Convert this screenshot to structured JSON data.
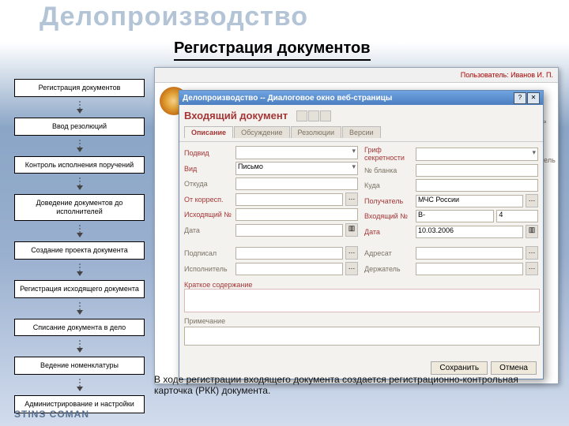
{
  "slide": {
    "title": "Делопроизводство",
    "subtitle": "Регистрация документов",
    "footer_text": "В ходе регистрации входящего документа создается регистрационно-контрольная карточка (РКК) документа.",
    "brand": "STINS COMAN"
  },
  "flow_steps": [
    "Регистрация документов",
    "Ввод резолюций",
    "Контроль исполнения поручений",
    "Доведение документов до исполнителей",
    "Создание проекта документа",
    "Регистрация исходящего документа",
    "Списание документа в дело",
    "Ведение номенклатуры",
    "Администрирование и настройки"
  ],
  "app": {
    "user_label": "Пользователь: Иванов И. П.",
    "back_title": "Делопроизводство",
    "consoles_label": "консоль",
    "holder_label": "держатель"
  },
  "dialog": {
    "title": "Делопроизводство -- Диалоговое окно веб-страницы",
    "window_title": "Входящий документ",
    "tabs": [
      "Описание",
      "Обсуждение",
      "Резолюции",
      "Версии"
    ],
    "left": {
      "podvid_lbl": "Подвид",
      "podvid_val": "",
      "vid_lbl": "Вид",
      "vid_val": "Письмо",
      "otkuda_lbl": "Откуда",
      "otkuda_val": "",
      "otkorresp_lbl": "От корресп.",
      "otkorresp_val": "",
      "iskhod_lbl": "Исходящий №",
      "iskhod_val": "",
      "data_lbl": "Дата",
      "data_val": ""
    },
    "right": {
      "grif_lbl": "Гриф секретности",
      "grif_val": "",
      "blank_lbl": "№ бланка",
      "blank_val": "",
      "kuda_lbl": "Куда",
      "kuda_val": "",
      "poluch_lbl": "Получатель",
      "poluch_val": "МЧС России",
      "vhod_lbl": "Входящий №",
      "vhod_val": "В-",
      "vhod_extra": "4",
      "data2_lbl": "Дата",
      "data2_val": "10.03.2006"
    },
    "bottom": {
      "podpisal_lbl": "Подписал",
      "podpisal_val": "",
      "adresat_lbl": "Адресат",
      "adresat_val": "",
      "ispolnitel_lbl": "Исполнитель",
      "ispolnitel_val": "",
      "derzhatel_lbl": "Держатель",
      "derzhatel_val": "",
      "kratkoe_lbl": "Краткое содержание",
      "prim_lbl": "Примечание"
    },
    "panel_label": "Описание",
    "buttons": {
      "save": "Сохранить",
      "cancel": "Отмена"
    }
  }
}
